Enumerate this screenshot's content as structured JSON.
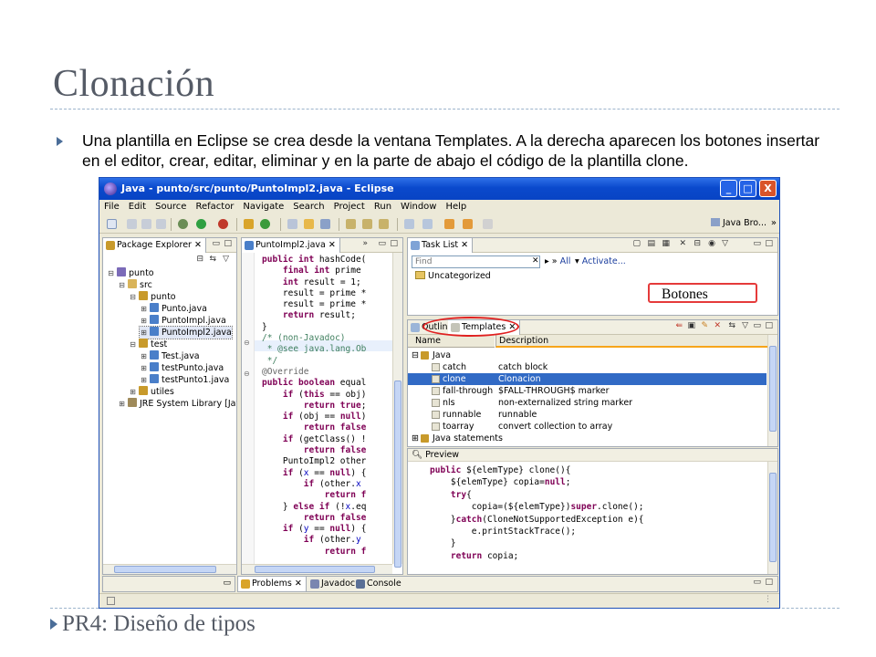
{
  "slide": {
    "title": "Clonación",
    "bullet": "Una plantilla en Eclipse se crea desde la ventana Templates. A la derecha aparecen los botones insertar en el editor, crear, editar, eliminar y en la parte de abajo el código de la plantilla clone.",
    "footer": "PR4: Diseño de tipos",
    "annotation_label": "Botones",
    "accent_color": "#4a6d98",
    "annotation_color": "#e53a3a"
  },
  "window": {
    "title": "Java - punto/src/punto/PuntoImpl2.java - Eclipse",
    "minimize": "_",
    "maximize": "□",
    "close": "X"
  },
  "menu": [
    "File",
    "Edit",
    "Source",
    "Refactor",
    "Navigate",
    "Search",
    "Project",
    "Run",
    "Window",
    "Help"
  ],
  "toolbar": {
    "perspective": "Java Bro...",
    "overflow": "»"
  },
  "explorer": {
    "tab": "Package Explorer",
    "tree": [
      {
        "label": "punto",
        "exp": "⊟",
        "icon": "project"
      },
      {
        "label": "src",
        "exp": "⊟",
        "icon": "folder"
      },
      {
        "label": "punto",
        "exp": "⊟",
        "icon": "package"
      },
      {
        "label": "Punto.java",
        "exp": "⊞",
        "icon": "java"
      },
      {
        "label": "PuntoImpl.java",
        "exp": "⊞",
        "icon": "java"
      },
      {
        "label": "PuntoImpl2.java",
        "exp": "⊞",
        "icon": "java",
        "selected": true
      },
      {
        "label": "test",
        "exp": "⊟",
        "icon": "package"
      },
      {
        "label": "Test.java",
        "exp": "⊞",
        "icon": "java"
      },
      {
        "label": "testPunto.java",
        "exp": "⊞",
        "icon": "java"
      },
      {
        "label": "testPunto1.java",
        "exp": "⊞",
        "icon": "java"
      },
      {
        "label": "utiles",
        "exp": "⊞",
        "icon": "package"
      },
      {
        "label": "JRE System Library [Java]",
        "exp": "⊞",
        "icon": "library"
      }
    ]
  },
  "editor": {
    "tab": "PuntoImpl2.java",
    "overflow": "»"
  },
  "tasklist": {
    "tab": "Task List",
    "find_placeholder": "Find",
    "all": "All",
    "activate": "Activate...",
    "category": "Uncategorized"
  },
  "templates": {
    "outline_tab": "Outline",
    "templates_tab": "Templates",
    "col_name": "Name",
    "col_description": "Description",
    "group": "Java",
    "rows": [
      {
        "name": "catch",
        "desc": "catch block"
      },
      {
        "name": "clone",
        "desc": "Clonacion",
        "selected": true
      },
      {
        "name": "fall-through",
        "desc": "$FALL-THROUGH$ marker"
      },
      {
        "name": "nls",
        "desc": "non-externalized string marker"
      },
      {
        "name": "runnable",
        "desc": "runnable"
      },
      {
        "name": "toarray",
        "desc": "convert collection to array"
      }
    ],
    "group2": "Java statements",
    "preview_label": "Preview"
  },
  "bottom_tabs": {
    "problems": "Problems",
    "javadoc": "Javadoc",
    "console": "Console"
  },
  "icon_colors": {
    "java": "#4a7fc9",
    "package": "#c89a2b",
    "folder": "#d9b45a",
    "project": "#7b6bb8",
    "library": "#9f8a5a"
  }
}
